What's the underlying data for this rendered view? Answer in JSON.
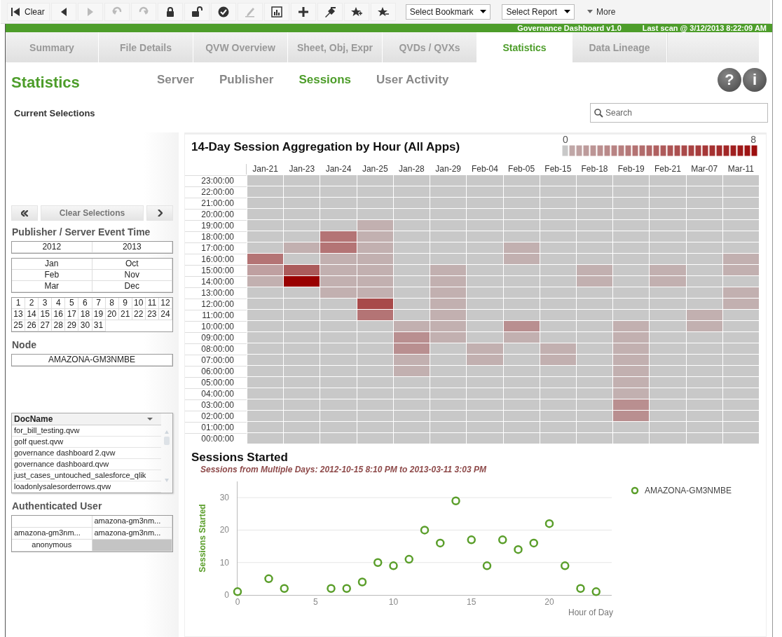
{
  "toolbar": {
    "buttons": [
      {
        "kind": "clear",
        "label": "Clear",
        "disabled": false
      },
      {
        "kind": "back",
        "disabled": false
      },
      {
        "kind": "forward",
        "disabled": true
      },
      {
        "kind": "undo",
        "disabled": true
      },
      {
        "kind": "redo",
        "disabled": true
      },
      {
        "kind": "lock",
        "disabled": false
      },
      {
        "kind": "unlock",
        "disabled": false
      },
      {
        "kind": "check",
        "disabled": false
      },
      {
        "kind": "pencil",
        "disabled": true
      },
      {
        "kind": "chart",
        "disabled": false
      },
      {
        "kind": "plus",
        "disabled": false
      },
      {
        "kind": "pin",
        "disabled": false
      },
      {
        "kind": "star-add",
        "disabled": false
      },
      {
        "kind": "star-remove",
        "disabled": false
      }
    ],
    "dropdowns": [
      {
        "label": "Select Bookmark"
      },
      {
        "label": "Select Report"
      }
    ],
    "more": {
      "label": "More"
    }
  },
  "banner": {
    "app": "Governance Dashboard v1.0",
    "scan": "Last scan @ 3/12/2013 8:22:09 AM"
  },
  "tabs": [
    {
      "label": "Summary",
      "selected": false
    },
    {
      "label": "File Details",
      "selected": false
    },
    {
      "label": "QVW Overview",
      "selected": false
    },
    {
      "label": "Sheet, Obj, Expr",
      "selected": false
    },
    {
      "label": "QVDs / QVXs",
      "selected": false
    },
    {
      "label": "Statistics",
      "selected": true
    },
    {
      "label": "Data Lineage",
      "selected": false
    }
  ],
  "page_title": "Statistics",
  "subtabs": [
    {
      "label": "Server",
      "selected": false
    },
    {
      "label": "Publisher",
      "selected": false
    },
    {
      "label": "Sessions",
      "selected": true
    },
    {
      "label": "User Activity",
      "selected": false
    }
  ],
  "header_buttons": [
    "?",
    "i"
  ],
  "current_selections": "Current Selections",
  "search": {
    "placeholder": "Search"
  },
  "sidebar": {
    "clear_button": "Clear Selections",
    "event_time": {
      "title": "Publisher / Server Event Time",
      "years": [
        "2012",
        "2013"
      ],
      "months": [
        "Jan",
        "Oct",
        "Feb",
        "Nov",
        "Mar",
        "Dec"
      ],
      "days": [
        "1",
        "2",
        "3",
        "4",
        "5",
        "6",
        "7",
        "8",
        "9",
        "10",
        "11",
        "12",
        "13",
        "14",
        "15",
        "16",
        "17",
        "18",
        "19",
        "20",
        "21",
        "22",
        "23",
        "24",
        "25",
        "26",
        "27",
        "28",
        "29",
        "30",
        "31"
      ]
    },
    "node": {
      "title": "Node",
      "values": [
        "AMAZONA-GM3NMBE"
      ]
    },
    "docname": {
      "header": "DocName",
      "items": [
        "for_bill_testing.qvw",
        "golf quest.qvw",
        "governance dashboard 2.qvw",
        "governance dashboard.qvw",
        "just_cases_untouched_salesforce_qlik",
        "loadonlysalesorderrows.qvw"
      ]
    },
    "auth_user": {
      "title": "Authenticated User",
      "rows": [
        [
          {
            "kind": "blank"
          },
          {
            "kind": "value",
            "text": "amazona-gm3nm..."
          }
        ],
        [
          {
            "kind": "value",
            "text": "amazona-gm3nm..."
          },
          {
            "kind": "value",
            "text": "amazona-gm3nm..."
          }
        ],
        [
          {
            "kind": "value",
            "text": "anonymous"
          },
          {
            "kind": "excluded"
          }
        ]
      ]
    }
  },
  "heatmap": {
    "title": "14-Day Session Aggregation by Hour (All Apps)",
    "legend": {
      "min": "0",
      "max": "8"
    },
    "columns": [
      "Jan-21",
      "Jan-23",
      "Jan-24",
      "Jan-25",
      "Jan-28",
      "Jan-29",
      "Feb-04",
      "Feb-05",
      "Feb-15",
      "Feb-18",
      "Feb-19",
      "Feb-21",
      "Mar-07",
      "Mar-11"
    ],
    "rows": [
      {
        "label": "23:00:00",
        "cells": [
          {
            "color": "#c8c8c8"
          },
          {
            "color": "#c8c8c8"
          },
          {
            "color": "#c8c8c8"
          },
          {
            "color": "#c8c8c8"
          },
          {
            "color": "#c8c8c8"
          },
          {
            "color": "#c8c8c8"
          },
          {
            "color": "#c8c8c8"
          },
          {
            "color": "#c8c8c8"
          },
          {
            "color": "#c8c8c8"
          },
          {
            "color": "#c8c8c8"
          },
          {
            "color": "#c8c8c8"
          },
          {
            "color": "#c8c8c8"
          },
          {
            "color": "#c8c8c8"
          },
          {
            "color": "#c8c8c8"
          }
        ]
      },
      {
        "label": "22:00:00",
        "cells": [
          {
            "color": "#c8c8c8"
          },
          {
            "color": "#c8c8c8"
          },
          {
            "color": "#c8c8c8"
          },
          {
            "color": "#c8c8c8"
          },
          {
            "color": "#c8c8c8"
          },
          {
            "color": "#c8c8c8"
          },
          {
            "color": "#c8c8c8"
          },
          {
            "color": "#c8c8c8"
          },
          {
            "color": "#c8c8c8"
          },
          {
            "color": "#c8c8c8"
          },
          {
            "color": "#c8c8c8"
          },
          {
            "color": "#c8c8c8"
          },
          {
            "color": "#c8c8c8"
          },
          {
            "color": "#c8c8c8"
          }
        ]
      },
      {
        "label": "21:00:00",
        "cells": [
          {
            "color": "#c8c8c8"
          },
          {
            "color": "#c8c8c8"
          },
          {
            "color": "#c8c8c8"
          },
          {
            "color": "#c8c8c8"
          },
          {
            "color": "#c8c8c8"
          },
          {
            "color": "#c8c8c8"
          },
          {
            "color": "#c8c8c8"
          },
          {
            "color": "#c8c8c8"
          },
          {
            "color": "#c8c8c8"
          },
          {
            "color": "#c8c8c8"
          },
          {
            "color": "#c8c8c8"
          },
          {
            "color": "#c8c8c8"
          },
          {
            "color": "#c8c8c8"
          },
          {
            "color": "#c8c8c8"
          }
        ]
      },
      {
        "label": "20:00:00",
        "cells": [
          {
            "color": "#c8c8c8"
          },
          {
            "color": "#c8c8c8"
          },
          {
            "color": "#c8c8c8"
          },
          {
            "color": "#c8c8c8"
          },
          {
            "color": "#c8c8c8"
          },
          {
            "color": "#c8c8c8"
          },
          {
            "color": "#c8c8c8"
          },
          {
            "color": "#c8c8c8"
          },
          {
            "color": "#c8c8c8"
          },
          {
            "color": "#c8c8c8"
          },
          {
            "color": "#c8c8c8"
          },
          {
            "color": "#c8c8c8"
          },
          {
            "color": "#c8c8c8"
          },
          {
            "color": "#c8c8c8"
          }
        ]
      },
      {
        "label": "19:00:00",
        "cells": [
          {
            "color": "#c8c8c8"
          },
          {
            "color": "#c8c8c8"
          },
          {
            "color": "#c8c8c8"
          },
          {
            "color": "#c2b0b0"
          },
          {
            "color": "#c8c8c8"
          },
          {
            "color": "#c8c8c8"
          },
          {
            "color": "#c8c8c8"
          },
          {
            "color": "#c8c8c8"
          },
          {
            "color": "#c8c8c8"
          },
          {
            "color": "#c8c8c8"
          },
          {
            "color": "#c8c8c8"
          },
          {
            "color": "#c8c8c8"
          },
          {
            "color": "#c8c8c8"
          },
          {
            "color": "#c8c8c8"
          }
        ]
      },
      {
        "label": "18:00:00",
        "cells": [
          {
            "color": "#c8c8c8"
          },
          {
            "color": "#c8c8c8"
          },
          {
            "color": "#b47475"
          },
          {
            "color": "#c2b0b0"
          },
          {
            "color": "#c8c8c8"
          },
          {
            "color": "#c8c8c8"
          },
          {
            "color": "#c8c8c8"
          },
          {
            "color": "#c8c8c8"
          },
          {
            "color": "#c8c8c8"
          },
          {
            "color": "#c8c8c8"
          },
          {
            "color": "#c8c8c8"
          },
          {
            "color": "#c8c8c8"
          },
          {
            "color": "#c8c8c8"
          },
          {
            "color": "#c8c8c8"
          }
        ]
      },
      {
        "label": "17:00:00",
        "cells": [
          {
            "color": "#c8c8c8"
          },
          {
            "color": "#c2b0b0"
          },
          {
            "color": "#b47475"
          },
          {
            "color": "#c2b0b0"
          },
          {
            "color": "#c8c8c8"
          },
          {
            "color": "#c8c8c8"
          },
          {
            "color": "#c8c8c8"
          },
          {
            "color": "#c2b0b0"
          },
          {
            "color": "#c8c8c8"
          },
          {
            "color": "#c8c8c8"
          },
          {
            "color": "#c8c8c8"
          },
          {
            "color": "#c8c8c8"
          },
          {
            "color": "#c8c8c8"
          },
          {
            "color": "#c8c8c8"
          }
        ]
      },
      {
        "label": "16:00:00",
        "cells": [
          {
            "color": "#b47475"
          },
          {
            "color": "#c8c8c8"
          },
          {
            "color": "#c2b0b0"
          },
          {
            "color": "#c2b0b0"
          },
          {
            "color": "#c8c8c8"
          },
          {
            "color": "#c8c8c8"
          },
          {
            "color": "#c8c8c8"
          },
          {
            "color": "#c2b0b0"
          },
          {
            "color": "#c8c8c8"
          },
          {
            "color": "#c8c8c8"
          },
          {
            "color": "#c8c8c8"
          },
          {
            "color": "#c8c8c8"
          },
          {
            "color": "#c8c8c8"
          },
          {
            "color": "#c2b0b0"
          }
        ]
      },
      {
        "label": "15:00:00",
        "cells": [
          {
            "color": "#bfa0a1"
          },
          {
            "color": "#ab5b5b"
          },
          {
            "color": "#c2b0b0"
          },
          {
            "color": "#c2b0b0"
          },
          {
            "color": "#c8c8c8"
          },
          {
            "color": "#c2b0b0"
          },
          {
            "color": "#c8c8c8"
          },
          {
            "color": "#c8c8c8"
          },
          {
            "color": "#c8c8c8"
          },
          {
            "color": "#c2b0b0"
          },
          {
            "color": "#c8c8c8"
          },
          {
            "color": "#c2b0b0"
          },
          {
            "color": "#c8c8c8"
          },
          {
            "color": "#c2b0b0"
          }
        ]
      },
      {
        "label": "14:00:00",
        "cells": [
          {
            "color": "#c2b0b0"
          },
          {
            "color": "#990000"
          },
          {
            "color": "#c2b0b0"
          },
          {
            "color": "#c2b0b0"
          },
          {
            "color": "#c8c8c8"
          },
          {
            "color": "#c2b0b0"
          },
          {
            "color": "#c8c8c8"
          },
          {
            "color": "#c8c8c8"
          },
          {
            "color": "#c8c8c8"
          },
          {
            "color": "#c2b0b0"
          },
          {
            "color": "#c8c8c8"
          },
          {
            "color": "#c2b0b0"
          },
          {
            "color": "#c8c8c8"
          },
          {
            "color": "#c8c8c8"
          }
        ]
      },
      {
        "label": "13:00:00",
        "cells": [
          {
            "color": "#c8c8c8"
          },
          {
            "color": "#c8c8c8"
          },
          {
            "color": "#c2b0b0"
          },
          {
            "color": "#c2b0b0"
          },
          {
            "color": "#c8c8c8"
          },
          {
            "color": "#c2b0b0"
          },
          {
            "color": "#c8c8c8"
          },
          {
            "color": "#c8c8c8"
          },
          {
            "color": "#c8c8c8"
          },
          {
            "color": "#c8c8c8"
          },
          {
            "color": "#c8c8c8"
          },
          {
            "color": "#c8c8c8"
          },
          {
            "color": "#c8c8c8"
          },
          {
            "color": "#c2b0b0"
          }
        ]
      },
      {
        "label": "12:00:00",
        "cells": [
          {
            "color": "#c8c8c8"
          },
          {
            "color": "#c8c8c8"
          },
          {
            "color": "#c8c8c8"
          },
          {
            "color": "#a84a4a"
          },
          {
            "color": "#c8c8c8"
          },
          {
            "color": "#c2b0b0"
          },
          {
            "color": "#c8c8c8"
          },
          {
            "color": "#c8c8c8"
          },
          {
            "color": "#c8c8c8"
          },
          {
            "color": "#c8c8c8"
          },
          {
            "color": "#c8c8c8"
          },
          {
            "color": "#c8c8c8"
          },
          {
            "color": "#c8c8c8"
          },
          {
            "color": "#c2b0b0"
          }
        ]
      },
      {
        "label": "11:00:00",
        "cells": [
          {
            "color": "#c8c8c8"
          },
          {
            "color": "#c8c8c8"
          },
          {
            "color": "#c8c8c8"
          },
          {
            "color": "#b47475"
          },
          {
            "color": "#c8c8c8"
          },
          {
            "color": "#c2b0b0"
          },
          {
            "color": "#c8c8c8"
          },
          {
            "color": "#c8c8c8"
          },
          {
            "color": "#c8c8c8"
          },
          {
            "color": "#c8c8c8"
          },
          {
            "color": "#c8c8c8"
          },
          {
            "color": "#c8c8c8"
          },
          {
            "color": "#c2b0b0"
          },
          {
            "color": "#c8c8c8"
          }
        ]
      },
      {
        "label": "10:00:00",
        "cells": [
          {
            "color": "#c8c8c8"
          },
          {
            "color": "#c8c8c8"
          },
          {
            "color": "#c8c8c8"
          },
          {
            "color": "#c8c8c8"
          },
          {
            "color": "#c2b0b0"
          },
          {
            "color": "#c2b0b0"
          },
          {
            "color": "#c8c8c8"
          },
          {
            "color": "#b98f90"
          },
          {
            "color": "#c8c8c8"
          },
          {
            "color": "#c8c8c8"
          },
          {
            "color": "#c2b0b0"
          },
          {
            "color": "#c8c8c8"
          },
          {
            "color": "#c2b0b0"
          },
          {
            "color": "#c8c8c8"
          }
        ]
      },
      {
        "label": "09:00:00",
        "cells": [
          {
            "color": "#c8c8c8"
          },
          {
            "color": "#c8c8c8"
          },
          {
            "color": "#c8c8c8"
          },
          {
            "color": "#c8c8c8"
          },
          {
            "color": "#b98f90"
          },
          {
            "color": "#c2b0b0"
          },
          {
            "color": "#c8c8c8"
          },
          {
            "color": "#c2b0b0"
          },
          {
            "color": "#c8c8c8"
          },
          {
            "color": "#c8c8c8"
          },
          {
            "color": "#c2b0b0"
          },
          {
            "color": "#c8c8c8"
          },
          {
            "color": "#c8c8c8"
          },
          {
            "color": "#c8c8c8"
          }
        ]
      },
      {
        "label": "08:00:00",
        "cells": [
          {
            "color": "#c8c8c8"
          },
          {
            "color": "#c8c8c8"
          },
          {
            "color": "#c8c8c8"
          },
          {
            "color": "#c8c8c8"
          },
          {
            "color": "#b98f90"
          },
          {
            "color": "#c8c8c8"
          },
          {
            "color": "#c2b0b0"
          },
          {
            "color": "#c8c8c8"
          },
          {
            "color": "#c2b0b0"
          },
          {
            "color": "#c8c8c8"
          },
          {
            "color": "#c2b0b0"
          },
          {
            "color": "#c8c8c8"
          },
          {
            "color": "#c8c8c8"
          },
          {
            "color": "#c8c8c8"
          }
        ]
      },
      {
        "label": "07:00:00",
        "cells": [
          {
            "color": "#c8c8c8"
          },
          {
            "color": "#c8c8c8"
          },
          {
            "color": "#c8c8c8"
          },
          {
            "color": "#c8c8c8"
          },
          {
            "color": "#c2b0b0"
          },
          {
            "color": "#c8c8c8"
          },
          {
            "color": "#c2b0b0"
          },
          {
            "color": "#c8c8c8"
          },
          {
            "color": "#c2b0b0"
          },
          {
            "color": "#c8c8c8"
          },
          {
            "color": "#c2b0b0"
          },
          {
            "color": "#c8c8c8"
          },
          {
            "color": "#c8c8c8"
          },
          {
            "color": "#c8c8c8"
          }
        ]
      },
      {
        "label": "06:00:00",
        "cells": [
          {
            "color": "#c8c8c8"
          },
          {
            "color": "#c8c8c8"
          },
          {
            "color": "#c8c8c8"
          },
          {
            "color": "#c8c8c8"
          },
          {
            "color": "#c2b0b0"
          },
          {
            "color": "#c8c8c8"
          },
          {
            "color": "#c8c8c8"
          },
          {
            "color": "#c8c8c8"
          },
          {
            "color": "#c8c8c8"
          },
          {
            "color": "#c8c8c8"
          },
          {
            "color": "#c2b0b0"
          },
          {
            "color": "#c8c8c8"
          },
          {
            "color": "#c8c8c8"
          },
          {
            "color": "#c8c8c8"
          }
        ]
      },
      {
        "label": "05:00:00",
        "cells": [
          {
            "color": "#c8c8c8"
          },
          {
            "color": "#c8c8c8"
          },
          {
            "color": "#c8c8c8"
          },
          {
            "color": "#c8c8c8"
          },
          {
            "color": "#c8c8c8"
          },
          {
            "color": "#c8c8c8"
          },
          {
            "color": "#c8c8c8"
          },
          {
            "color": "#c8c8c8"
          },
          {
            "color": "#c8c8c8"
          },
          {
            "color": "#c8c8c8"
          },
          {
            "color": "#c2b0b0"
          },
          {
            "color": "#c8c8c8"
          },
          {
            "color": "#c8c8c8"
          },
          {
            "color": "#c8c8c8"
          }
        ]
      },
      {
        "label": "04:00:00",
        "cells": [
          {
            "color": "#c8c8c8"
          },
          {
            "color": "#c8c8c8"
          },
          {
            "color": "#c8c8c8"
          },
          {
            "color": "#c8c8c8"
          },
          {
            "color": "#c8c8c8"
          },
          {
            "color": "#c8c8c8"
          },
          {
            "color": "#c8c8c8"
          },
          {
            "color": "#c8c8c8"
          },
          {
            "color": "#c8c8c8"
          },
          {
            "color": "#c8c8c8"
          },
          {
            "color": "#c2b0b0"
          },
          {
            "color": "#c8c8c8"
          },
          {
            "color": "#c8c8c8"
          },
          {
            "color": "#c8c8c8"
          }
        ]
      },
      {
        "label": "03:00:00",
        "cells": [
          {
            "color": "#c8c8c8"
          },
          {
            "color": "#c8c8c8"
          },
          {
            "color": "#c8c8c8"
          },
          {
            "color": "#c8c8c8"
          },
          {
            "color": "#c8c8c8"
          },
          {
            "color": "#c8c8c8"
          },
          {
            "color": "#c8c8c8"
          },
          {
            "color": "#c8c8c8"
          },
          {
            "color": "#c8c8c8"
          },
          {
            "color": "#c8c8c8"
          },
          {
            "color": "#b98f90"
          },
          {
            "color": "#c8c8c8"
          },
          {
            "color": "#c8c8c8"
          },
          {
            "color": "#c8c8c8"
          }
        ]
      },
      {
        "label": "02:00:00",
        "cells": [
          {
            "color": "#c8c8c8"
          },
          {
            "color": "#c8c8c8"
          },
          {
            "color": "#c8c8c8"
          },
          {
            "color": "#c8c8c8"
          },
          {
            "color": "#c8c8c8"
          },
          {
            "color": "#c8c8c8"
          },
          {
            "color": "#c8c8c8"
          },
          {
            "color": "#c8c8c8"
          },
          {
            "color": "#c8c8c8"
          },
          {
            "color": "#c8c8c8"
          },
          {
            "color": "#b98f90"
          },
          {
            "color": "#c8c8c8"
          },
          {
            "color": "#c8c8c8"
          },
          {
            "color": "#c8c8c8"
          }
        ]
      },
      {
        "label": "01:00:00",
        "cells": [
          {
            "color": "#c8c8c8"
          },
          {
            "color": "#c8c8c8"
          },
          {
            "color": "#c8c8c8"
          },
          {
            "color": "#c8c8c8"
          },
          {
            "color": "#c8c8c8"
          },
          {
            "color": "#c8c8c8"
          },
          {
            "color": "#c8c8c8"
          },
          {
            "color": "#c8c8c8"
          },
          {
            "color": "#c8c8c8"
          },
          {
            "color": "#c8c8c8"
          },
          {
            "color": "#c8c8c8"
          },
          {
            "color": "#c8c8c8"
          },
          {
            "color": "#c8c8c8"
          },
          {
            "color": "#c8c8c8"
          }
        ]
      },
      {
        "label": "00:00:00",
        "cells": [
          {
            "color": "#c8c8c8"
          },
          {
            "color": "#c8c8c8"
          },
          {
            "color": "#c8c8c8"
          },
          {
            "color": "#c8c8c8"
          },
          {
            "color": "#c8c8c8"
          },
          {
            "color": "#c8c8c8"
          },
          {
            "color": "#c8c8c8"
          },
          {
            "color": "#c8c8c8"
          },
          {
            "color": "#c8c8c8"
          },
          {
            "color": "#c8c8c8"
          },
          {
            "color": "#c8c8c8"
          },
          {
            "color": "#c8c8c8"
          },
          {
            "color": "#c8c8c8"
          },
          {
            "color": "#c8c8c8"
          }
        ]
      }
    ]
  },
  "sessions": {
    "title": "Sessions Started",
    "subtitle": "Sessions from Multiple Days: 2012-10-15  8:10 PM to 2013-03-11  3:03 PM",
    "chart_data": {
      "type": "scatter",
      "xlabel": "Hour of Day",
      "ylabel": "Sessions Started",
      "x": [
        0,
        2,
        3,
        6,
        7,
        8,
        9,
        10,
        11,
        12,
        13,
        14,
        15,
        16,
        17,
        18,
        19,
        20,
        21,
        22,
        23
      ],
      "series": [
        {
          "name": "AMAZONA-GM3NMBE",
          "color": "#5a9e2a",
          "values": [
            1,
            5,
            2,
            2,
            2,
            4,
            10,
            9,
            11,
            20,
            16,
            29,
            17,
            9,
            17,
            14,
            16,
            22,
            9,
            2,
            1
          ]
        }
      ],
      "xlim": [
        0,
        24
      ],
      "ylim": [
        0,
        35
      ],
      "xticks": [
        0,
        5,
        10,
        15,
        20
      ],
      "yticks": [
        0,
        10,
        20,
        30
      ],
      "grid": true
    }
  }
}
